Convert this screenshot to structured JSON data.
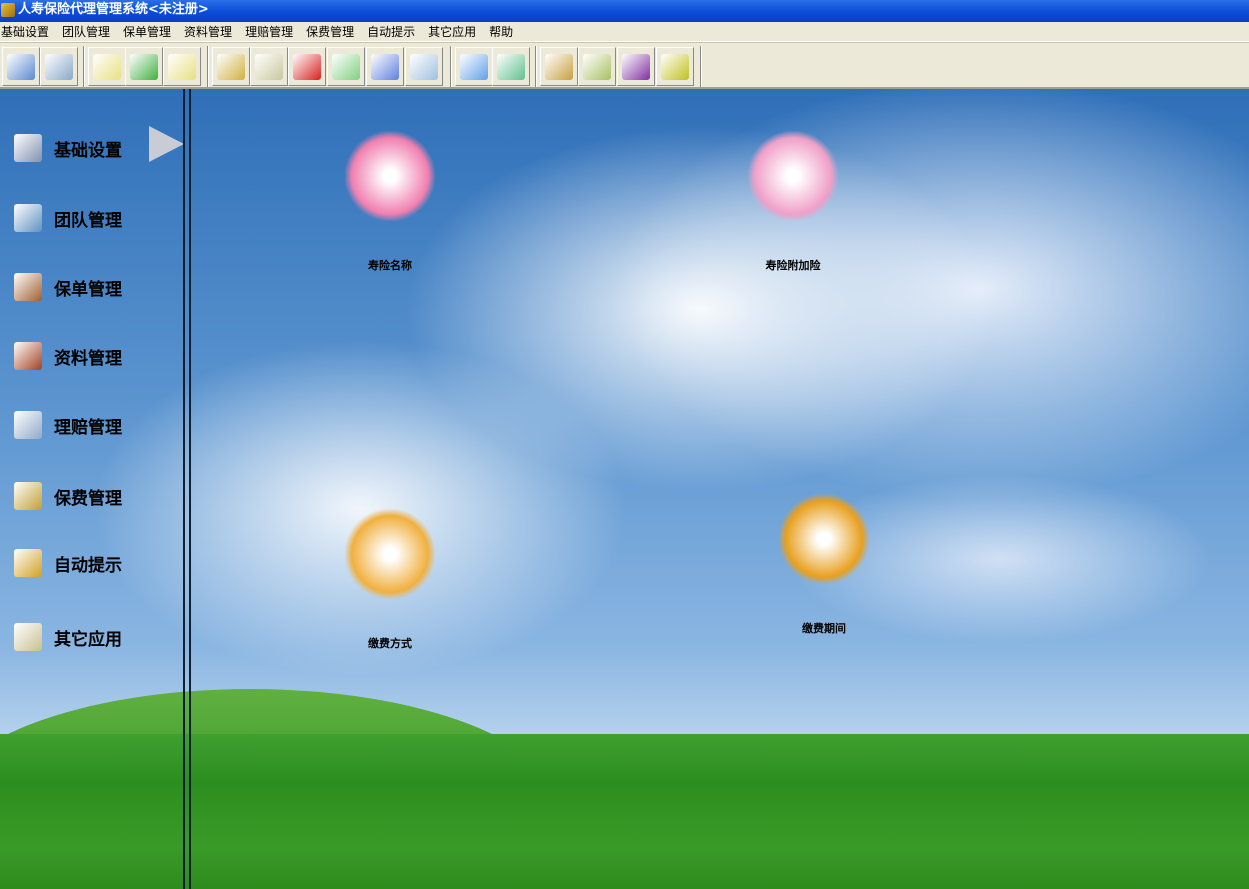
{
  "window": {
    "title": "人寿保险代理管理系统<未注册>"
  },
  "menu": [
    "基础设置",
    "团队管理",
    "保单管理",
    "资料管理",
    "理赔管理",
    "保费管理",
    "自动提示",
    "其它应用",
    "帮助"
  ],
  "toolbar": [
    {
      "icon": "desktop-monitor-icon",
      "color": "#5a8ad0"
    },
    {
      "icon": "computer-screen-icon",
      "color": "#8aa8c8"
    },
    {
      "icon": "open-folder-icon",
      "color": "#e8e080"
    },
    {
      "icon": "connect-icon",
      "color": "#40b040"
    },
    {
      "icon": "folder-icon",
      "color": "#e8e080"
    },
    {
      "icon": "compress-folder-icon",
      "color": "#d0b040"
    },
    {
      "icon": "file-transfer-icon",
      "color": "#c8c8a0"
    },
    {
      "icon": "umbrella-icon",
      "color": "#d82020"
    },
    {
      "icon": "notebook-icon",
      "color": "#80d080"
    },
    {
      "icon": "grid-search-icon",
      "color": "#6080e0"
    },
    {
      "icon": "magnifier-icon",
      "color": "#a0c0e0"
    },
    {
      "icon": "bell-icon",
      "color": "#60a0e8"
    },
    {
      "icon": "open-book-icon",
      "color": "#60c090"
    },
    {
      "icon": "picture-icon",
      "color": "#c8a040"
    },
    {
      "icon": "pda-icon",
      "color": "#a8c060"
    },
    {
      "icon": "help-book-icon",
      "color": "#8030a0"
    },
    {
      "icon": "runner-icon",
      "color": "#c0c020"
    }
  ],
  "sidebar": [
    {
      "label": "基础设置",
      "icon": "tools-icon",
      "color": "#8090b0"
    },
    {
      "label": "团队管理",
      "icon": "team-folder-icon",
      "color": "#6090c0"
    },
    {
      "label": "保单管理",
      "icon": "book-icon",
      "color": "#a06030"
    },
    {
      "label": "资料管理",
      "icon": "binder-icon",
      "color": "#a04020"
    },
    {
      "label": "理赔管理",
      "icon": "monitor-icon",
      "color": "#90a8c8"
    },
    {
      "label": "保费管理",
      "icon": "car-icon",
      "color": "#c0a030"
    },
    {
      "label": "自动提示",
      "icon": "bell-icon",
      "color": "#d0a020"
    },
    {
      "label": "其它应用",
      "icon": "note-icon",
      "color": "#c8c090"
    }
  ],
  "desktop": [
    {
      "label": "寿险名称",
      "icon": "girl-pumpkin-icon",
      "color": "#f080b0"
    },
    {
      "label": "寿险附加险",
      "icon": "clock-wreath-icon",
      "color": "#f0a0c8"
    },
    {
      "label": "缴费方式",
      "icon": "money-folder-icon",
      "color": "#f0b040"
    },
    {
      "label": "缴费期间",
      "icon": "alarm-clock-icon",
      "color": "#e8a020"
    }
  ]
}
